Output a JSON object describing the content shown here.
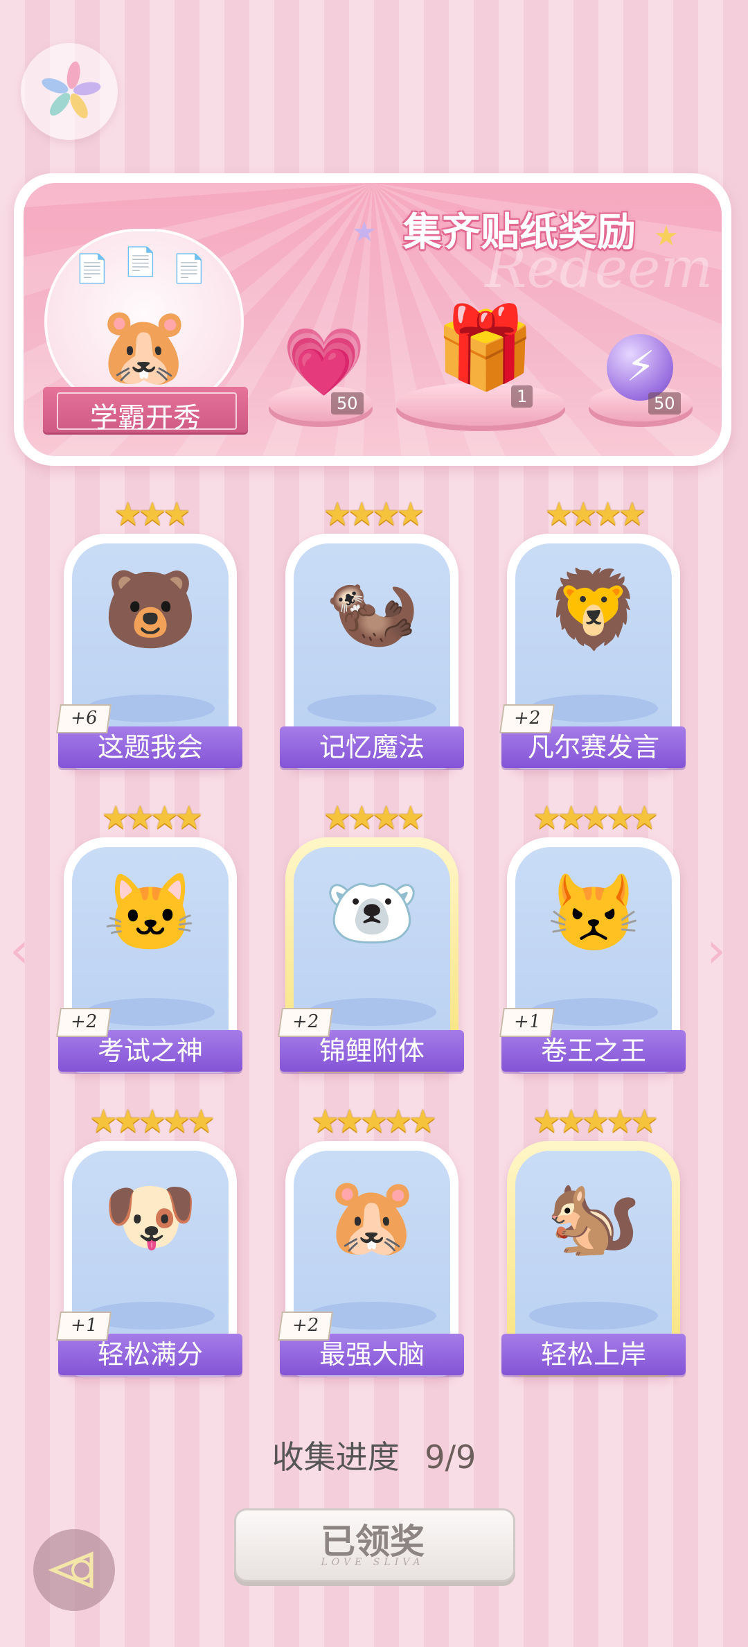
{
  "banner": {
    "title": "集齐贴纸奖励",
    "watermark": "Redeem",
    "feature_label": "学霸开秀",
    "rewards": [
      {
        "name": "heart-gem",
        "count": "50"
      },
      {
        "name": "gift-box",
        "count": "1"
      },
      {
        "name": "energy-orb",
        "count": "50"
      }
    ]
  },
  "stickers": [
    {
      "label": "这题我会",
      "plus": "+6",
      "stars": "★★★",
      "gold": false,
      "mascot": "🐻"
    },
    {
      "label": "记忆魔法",
      "plus": "",
      "stars": "★★★★",
      "gold": false,
      "mascot": "🦦"
    },
    {
      "label": "凡尔赛发言",
      "plus": "+2",
      "stars": "★★★★",
      "gold": false,
      "mascot": "🦁"
    },
    {
      "label": "考试之神",
      "plus": "+2",
      "stars": "★★★★",
      "gold": false,
      "mascot": "🐱"
    },
    {
      "label": "锦鲤附体",
      "plus": "+2",
      "stars": "★★★★",
      "gold": true,
      "mascot": "🐻‍❄️"
    },
    {
      "label": "卷王之王",
      "plus": "+1",
      "stars": "★★★★★",
      "gold": false,
      "mascot": "😾"
    },
    {
      "label": "轻松满分",
      "plus": "+1",
      "stars": "★★★★★",
      "gold": false,
      "mascot": "🐶"
    },
    {
      "label": "最强大脑",
      "plus": "+2",
      "stars": "★★★★★",
      "gold": false,
      "mascot": "🐹"
    },
    {
      "label": "轻松上岸",
      "plus": "",
      "stars": "★★★★★",
      "gold": true,
      "mascot": "🐿️"
    }
  ],
  "progress": {
    "label": "收集进度",
    "value": "9/9"
  },
  "claim": {
    "label": "已领奖",
    "sub": "LOVE SLIVA"
  },
  "nav": {
    "prev": "‹",
    "next": "›"
  }
}
